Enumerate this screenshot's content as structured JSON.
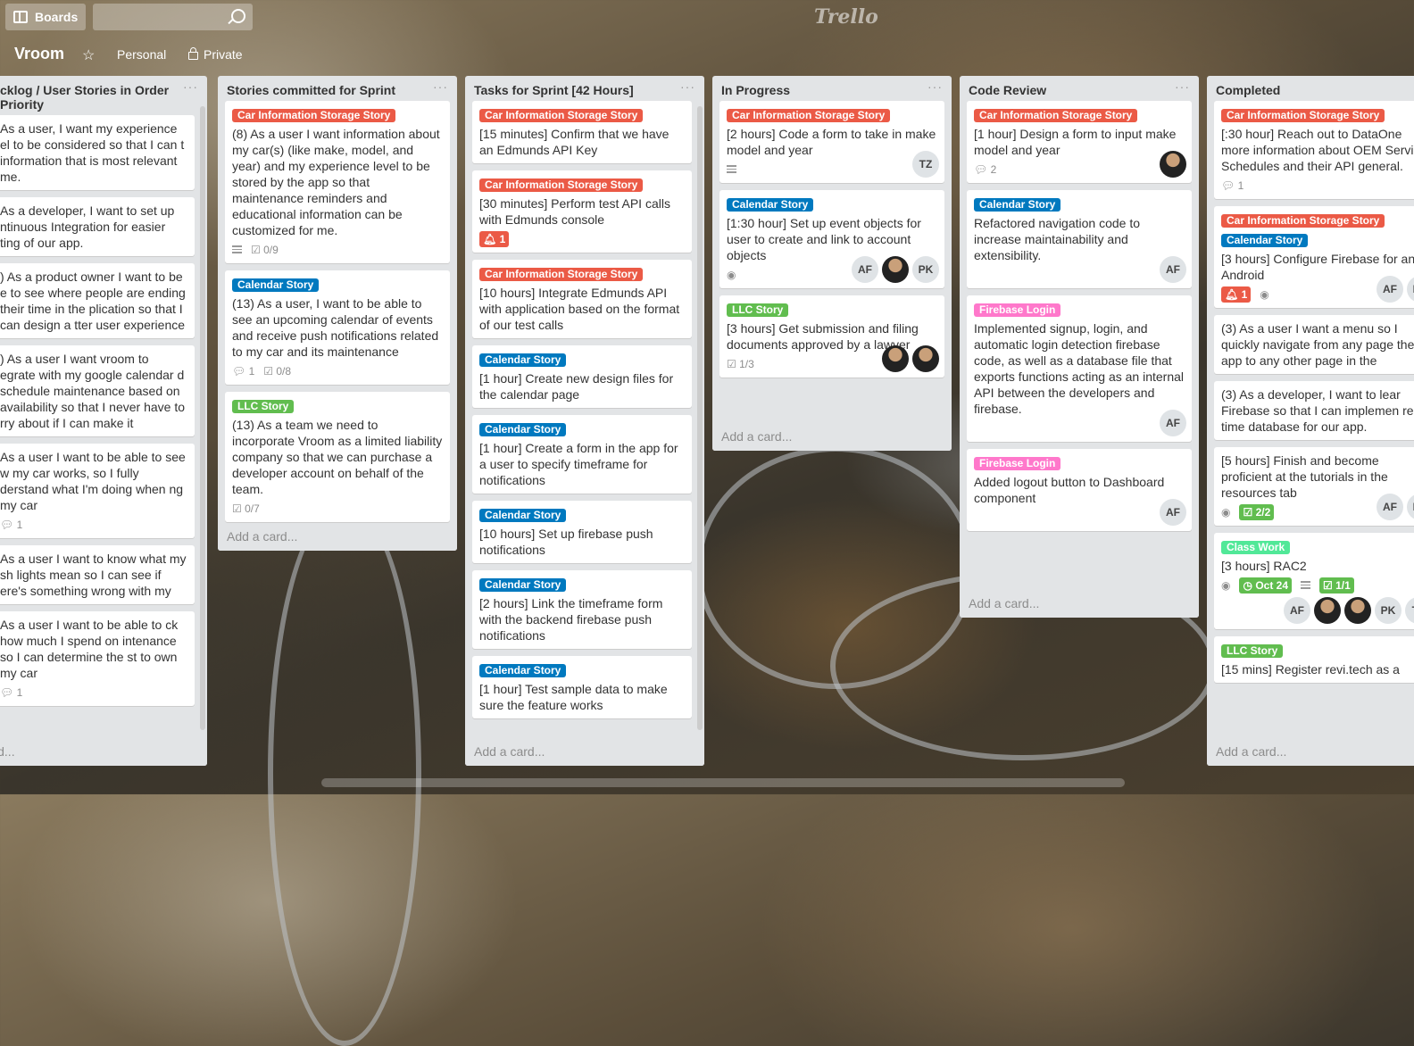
{
  "header": {
    "boards_label": "Boards",
    "logo": "Trello"
  },
  "board": {
    "title": "Vroom",
    "visibility_team": "Personal",
    "visibility_privacy": "Private"
  },
  "icons": [
    "boards-icon",
    "search-icon",
    "star-icon",
    "lock-icon",
    "description-icon",
    "comment-icon",
    "checklist-icon",
    "bell-icon",
    "eye-icon",
    "clock-icon"
  ],
  "colors": {
    "red": "#eb5a46",
    "blue": "#0079bf",
    "green": "#61bd4f",
    "pink": "#ff78cb",
    "lime": "#51e898",
    "list_bg": "#e2e4e6"
  },
  "lists": [
    {
      "title": "cklog / User Stories in Order Priority",
      "add": "a card...",
      "cards": [
        {
          "text": "As a user, I want my experience el to be considered so that I can t information that is most relevant me."
        },
        {
          "text": "As a developer, I want to set up ntinuous Integration for easier ting of our app."
        },
        {
          "text": ") As a product owner I want to be e to see where people are ending their time in the plication so that I can design a tter user experience"
        },
        {
          "text": ") As a user I want vroom to egrate with my google calendar d schedule maintenance based on availability so that I never have to rry about if I can make it"
        },
        {
          "text": "As a user I want to be able to see w my car works, so I fully derstand what I'm doing when ng my car",
          "comments": "1"
        },
        {
          "text": "As a user I want to know what my sh lights mean so I can see if ere's something wrong with my"
        },
        {
          "text": "As a user I want to be able to ck how much I spend on intenance so I can determine the st to own my car",
          "comments": "1"
        }
      ]
    },
    {
      "title": "Stories committed for Sprint",
      "add": "Add a card...",
      "cards": [
        {
          "label": "Car Information Storage Story",
          "color": "red",
          "text": "(8) As a user I want information about my car(s) (like make, model, and year) and my experience level to be stored by the app so that maintenance reminders and educational information can be customized for me.",
          "checklist": "0/9",
          "desc": true
        },
        {
          "label": "Calendar Story",
          "color": "blue",
          "text": "(13) As a user, I want to be able to see an upcoming calendar of events and receive push notifications related to my car and its maintenance",
          "comments": "1",
          "checklist": "0/8"
        },
        {
          "label": "LLC Story",
          "color": "green",
          "text": "(13) As a team we need to incorporate Vroom as a limited liability company so that we can purchase a developer account on behalf of the team.",
          "checklist": "0/7"
        }
      ]
    },
    {
      "title": "Tasks for Sprint [42 Hours]",
      "add": "Add a card...",
      "cards": [
        {
          "label": "Car Information Storage Story",
          "color": "red",
          "text": "[15 minutes] Confirm that we have an Edmunds API Key"
        },
        {
          "label": "Car Information Storage Story",
          "color": "red",
          "text": "[30 minutes] Perform test API calls with Edmunds console",
          "alert": "1"
        },
        {
          "label": "Car Information Storage Story",
          "color": "red",
          "text": "[10 hours] Integrate Edmunds API with application based on the format of our test calls"
        },
        {
          "label": "Calendar Story",
          "color": "blue",
          "text": "[1 hour] Create new design files for the calendar page"
        },
        {
          "label": "Calendar Story",
          "color": "blue",
          "text": "[1 hour] Create a form in the app for a user to specify timeframe for notifications"
        },
        {
          "label": "Calendar Story",
          "color": "blue",
          "text": "[10 hours] Set up firebase push notifications"
        },
        {
          "label": "Calendar Story",
          "color": "blue",
          "text": "[2 hours] Link the timeframe form with the backend firebase push notifications"
        },
        {
          "label": "Calendar Story",
          "color": "blue",
          "text": "[1 hour] Test sample data to make sure the feature works"
        }
      ]
    },
    {
      "title": "In Progress",
      "add": "Add a card...",
      "cards": [
        {
          "label": "Car Information Storage Story",
          "color": "red",
          "text": "[2 hours] Code a form to take in make model and year",
          "desc": true,
          "members": [
            "TZ"
          ]
        },
        {
          "label": "Calendar Story",
          "color": "blue",
          "text": "[1:30 hour] Set up event objects for user to create and link to account objects",
          "watch": true,
          "members": [
            "AF",
            "photo",
            "PK"
          ]
        },
        {
          "label": "LLC Story",
          "color": "green",
          "text": "[3 hours] Get submission and filing documents approved by a lawyer",
          "checklist": "1/3",
          "members": [
            "photo",
            "photo"
          ]
        }
      ]
    },
    {
      "title": "Code Review",
      "add": "Add a card...",
      "cards": [
        {
          "label": "Car Information Storage Story",
          "color": "red",
          "text": "[1 hour] Design a form to input make model and year",
          "comments": "2",
          "members": [
            "photo"
          ]
        },
        {
          "label": "Calendar Story",
          "color": "blue",
          "text": "Refactored navigation code to increase maintainability and extensibility.",
          "members": [
            "AF"
          ]
        },
        {
          "label": "Firebase Login",
          "color": "pink",
          "text": "Implemented signup, login, and automatic login detection firebase code, as well as a database file that exports functions acting as an internal API between the developers and firebase.",
          "members": [
            "AF"
          ]
        },
        {
          "label": "Firebase Login",
          "color": "pink",
          "text": "Added logout button to Dashboard component",
          "members": [
            "AF"
          ]
        }
      ]
    },
    {
      "title": "Completed",
      "add": "Add a card...",
      "cards": [
        {
          "label": "Car Information Storage Story",
          "color": "red",
          "text": "[:30 hour] Reach out to DataOne more information about OEM Service Schedules and their API general.",
          "comments": "1"
        },
        {
          "label": "Car Information Storage Story",
          "color": "red",
          "label2": "Calendar Story",
          "color2": "blue",
          "text": "[3 hours] Configure Firebase for and Android",
          "alert": "1",
          "watch": true,
          "members": [
            "AF",
            "PK"
          ]
        },
        {
          "text": "(3) As a user I want a menu so I quickly navigate from any page the app to any other page in the"
        },
        {
          "text": "(3) As a developer, I want to lear Firebase so that I can implemen real-time database for our app."
        },
        {
          "text": "[5 hours] Finish and become proficient at the tutorials in the resources tab",
          "watch": true,
          "checklist_done": "2/2",
          "members": [
            "AF",
            "PK"
          ]
        },
        {
          "label": "Class Work",
          "color": "lime",
          "text": "[3 hours] RAC2",
          "watch": true,
          "due": "Oct 24",
          "desc": true,
          "checklist_done": "1/1",
          "members": [
            "AF",
            "photo",
            "photo",
            "PK",
            "TZ"
          ]
        },
        {
          "label": "LLC Story",
          "color": "green",
          "text": "[15 mins] Register revi.tech as a"
        }
      ]
    }
  ]
}
